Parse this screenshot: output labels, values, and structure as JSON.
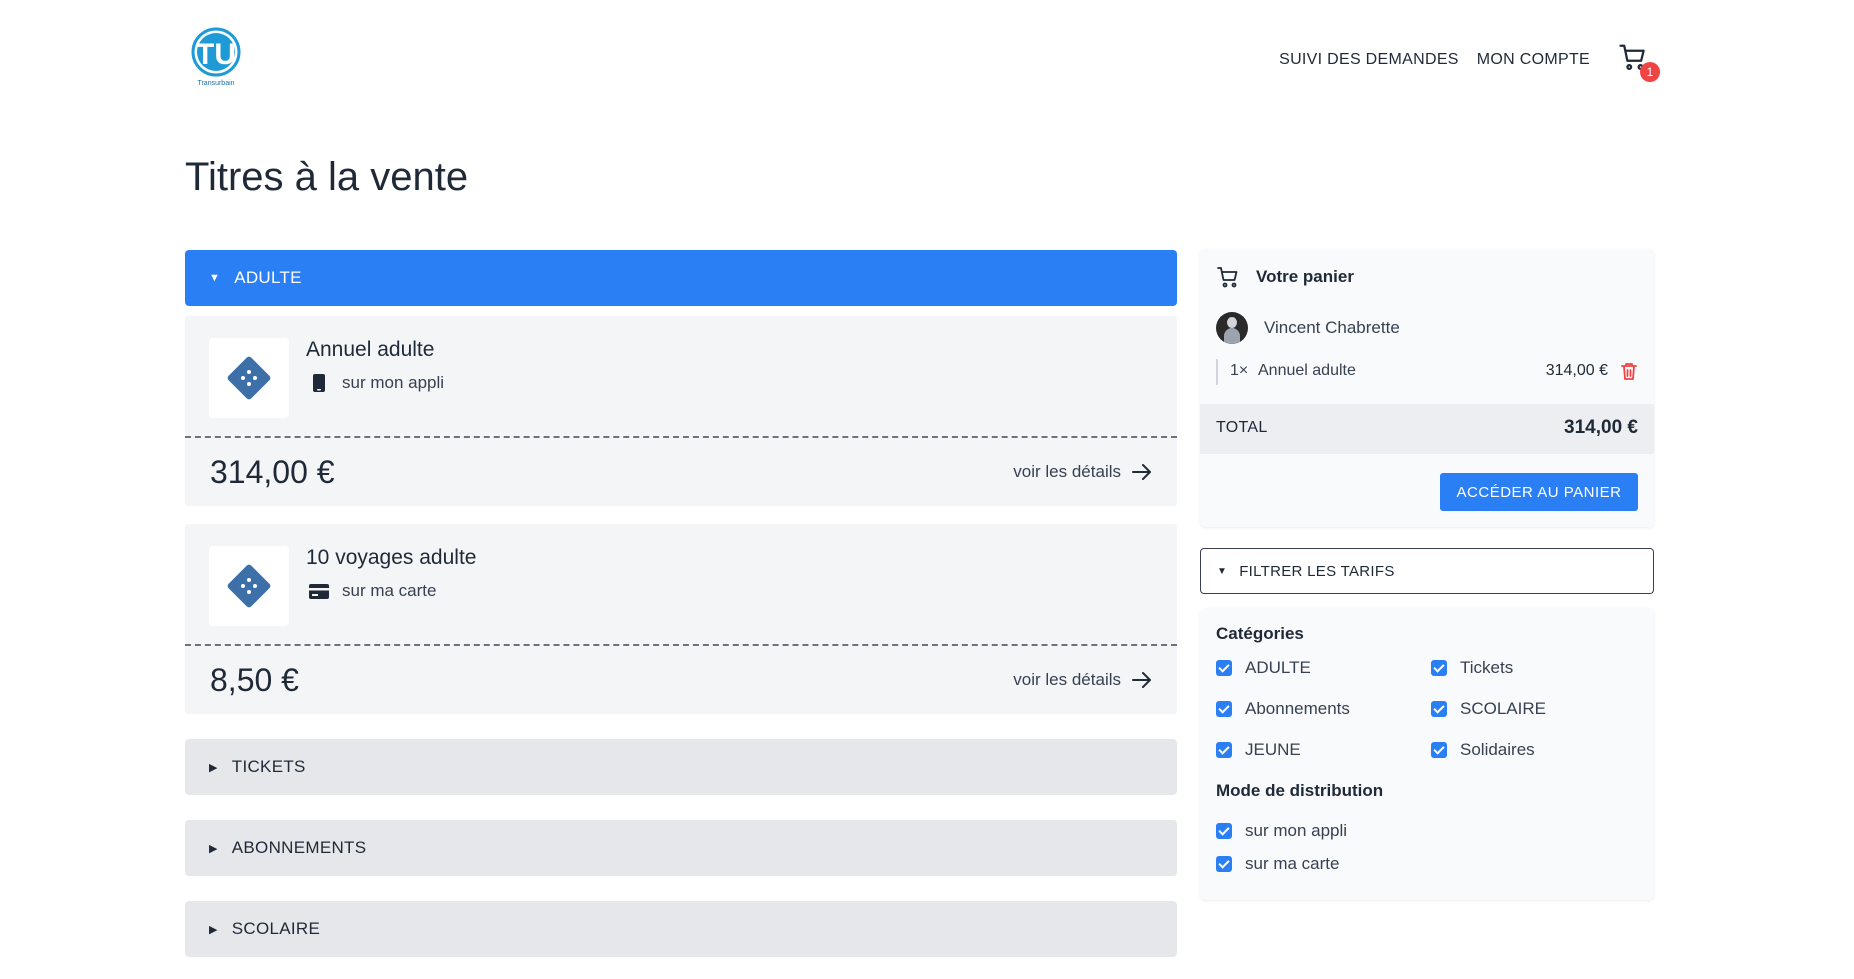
{
  "header": {
    "logo_text": "TU",
    "logo_subtext": "Transurbain",
    "nav": [
      "SUIVI DES DEMANDES",
      "MON COMPTE"
    ],
    "cart_count": "1"
  },
  "page_title": "Titres à la vente",
  "catalog": {
    "open_section": "ADULTE",
    "products": [
      {
        "name": "Annuel adulte",
        "mode": "sur mon appli",
        "mode_icon": "phone-icon",
        "price": "314,00 €",
        "link": "voir les détails"
      },
      {
        "name": "10 voyages adulte",
        "mode": "sur ma carte",
        "mode_icon": "card-icon",
        "price": "8,50 €",
        "link": "voir les détails"
      }
    ],
    "closed_sections": [
      "TICKETS",
      "ABONNEMENTS",
      "SCOLAIRE"
    ]
  },
  "cart": {
    "title": "Votre panier",
    "user": "Vincent Chabrette",
    "item_qty": "1×",
    "item_name": "Annuel adulte",
    "item_price": "314,00 €",
    "total_label": "TOTAL",
    "total_value": "314,00 €",
    "button": "ACCÉDER AU PANIER"
  },
  "filters": {
    "toggle": "FILTRER LES TARIFS",
    "categories_title": "Catégories",
    "categories": [
      "ADULTE",
      "Tickets",
      "Abonnements",
      "SCOLAIRE",
      "JEUNE",
      "Solidaires"
    ],
    "distribution_title": "Mode de distribution",
    "distribution": [
      "sur mon appli",
      "sur ma carte"
    ]
  },
  "colors": {
    "accent": "#2b7ff5",
    "badge": "#ef4444",
    "ticket": "#3d6fa8"
  }
}
